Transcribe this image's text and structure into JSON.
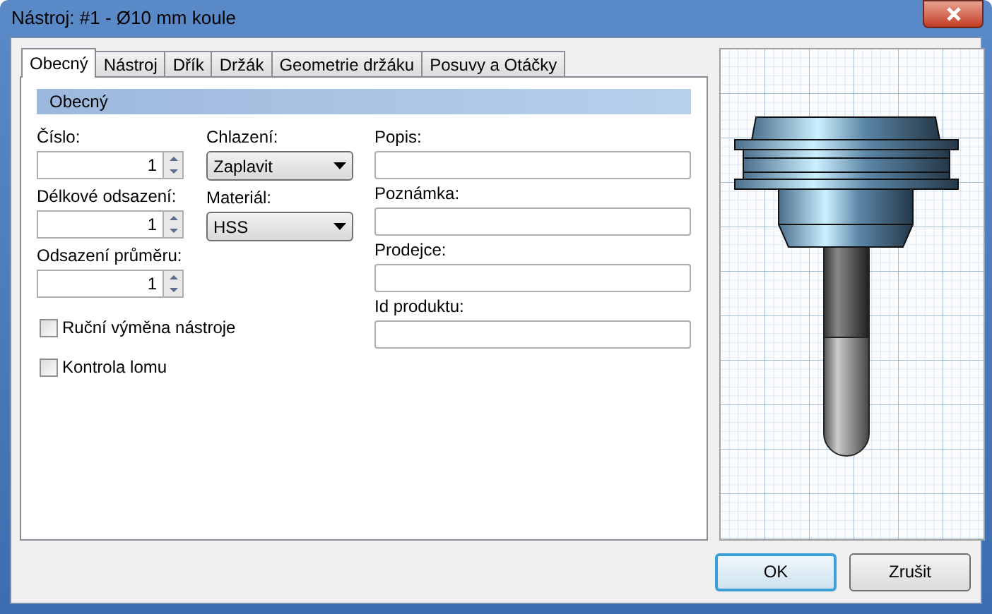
{
  "window": {
    "title": "Nástroj: #1 - Ø10 mm koule"
  },
  "tabs": [
    {
      "label": "Obecný",
      "selected": true
    },
    {
      "label": "Nástroj",
      "selected": false
    },
    {
      "label": "Dřík",
      "selected": false
    },
    {
      "label": "Držák",
      "selected": false
    },
    {
      "label": "Geometrie držáku",
      "selected": false
    },
    {
      "label": "Posuvy a Otáčky",
      "selected": false
    }
  ],
  "section": {
    "title": "Obecný"
  },
  "columns": [
    [
      {
        "kind": "spin",
        "label": "Číslo:",
        "spinner": {
          "value": "1"
        }
      },
      {
        "kind": "spin",
        "label": "Délkové odsazení:",
        "spinner": {
          "value": "1"
        }
      },
      {
        "kind": "spin",
        "label": "Odsazení průměru:",
        "spinner": {
          "value": "1"
        }
      },
      {
        "kind": "checkbox",
        "label": "Ruční výměna nástroje",
        "checked": false
      },
      {
        "kind": "checkbox",
        "label": "Kontrola lomu",
        "checked": false
      }
    ],
    [
      {
        "kind": "dropdown",
        "label": "Chlazení:",
        "value": "Zaplavit"
      },
      {
        "kind": "dropdown",
        "label": "Materiál:",
        "value": "HSS"
      }
    ],
    [
      {
        "kind": "text",
        "label": "Popis:"
      },
      {
        "kind": "text",
        "label": "Poznámka:"
      },
      {
        "kind": "text",
        "label": "Prodejce:"
      },
      {
        "kind": "text",
        "label": "Id produktu:"
      }
    ]
  ],
  "buttons": [
    {
      "label": "OK",
      "default": true
    },
    {
      "label": "Zrušit",
      "default": false
    }
  ]
}
